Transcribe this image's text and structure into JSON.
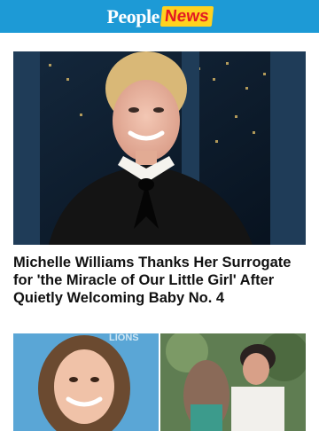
{
  "header": {
    "logo_people": "People",
    "logo_news": "News",
    "background_color": "#1d9ad6"
  },
  "article": {
    "headline": "Michelle Williams Thanks Her Surrogate for 'the Miracle of Our Little Girl' After Quietly Welcoming Baby No. 4"
  },
  "thumbnails": {
    "left_backdrop_text": "LIONS"
  }
}
